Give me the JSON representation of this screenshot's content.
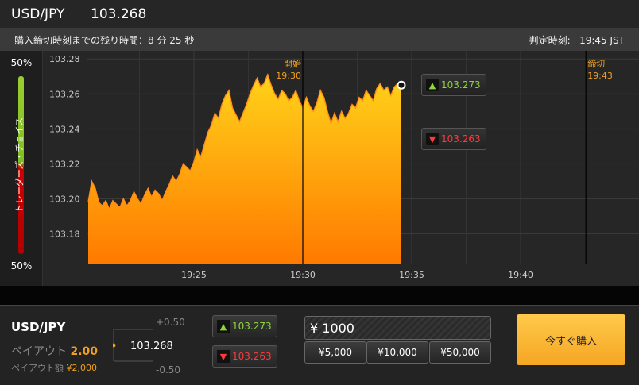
{
  "header": {
    "pair": "USD/JPY",
    "price": "103.268"
  },
  "subbar": {
    "remaining_label": "購入締切時刻までの残り時間：8 分 25 秒",
    "judge_label": "判定時刻:",
    "judge_time": "19:45 JST"
  },
  "traders_choice": {
    "label": "トレーダーズ・チョイス",
    "top_pct": "50%",
    "bottom_pct": "50%",
    "arrow": "‹"
  },
  "chart_data": {
    "type": "area",
    "y_ticks": [
      "103.28",
      "103.26",
      "103.24",
      "103.22",
      "103.20",
      "103.18"
    ],
    "x_ticks": [
      "19:25",
      "19:30",
      "19:35",
      "19:40"
    ],
    "ylim": [
      103.163,
      103.281
    ],
    "markers": [
      {
        "label": "開始",
        "time": "19:30"
      },
      {
        "label": "締切",
        "time": "19:43"
      }
    ],
    "current_price": "103.268",
    "series": [
      {
        "values": [
          103.198,
          103.21,
          103.206,
          103.198,
          103.196,
          103.199,
          103.194,
          103.199,
          103.197,
          103.195,
          103.2,
          103.196,
          103.199,
          103.204,
          103.2,
          103.197,
          103.202,
          103.206,
          103.201,
          103.205,
          103.203,
          103.199,
          103.204,
          103.208,
          103.213,
          103.21,
          103.214,
          103.22,
          103.218,
          103.216,
          103.221,
          103.228,
          103.224,
          103.231,
          103.238,
          103.242,
          103.249,
          103.246,
          103.254,
          103.259,
          103.262,
          103.252,
          103.248,
          103.244,
          103.249,
          103.254,
          103.26,
          103.265,
          103.269,
          103.264,
          103.266,
          103.271,
          103.265,
          103.26,
          103.257,
          103.262,
          103.26,
          103.256,
          103.258,
          103.262,
          103.256,
          103.252,
          103.258,
          103.253,
          103.25,
          103.255,
          103.262,
          103.258,
          103.25,
          103.243,
          103.249,
          103.244,
          103.25,
          103.246,
          103.249,
          103.254,
          103.252,
          103.258,
          103.256,
          103.262,
          103.259,
          103.256,
          103.263,
          103.266,
          103.262,
          103.264,
          103.259,
          103.264,
          103.266,
          103.265
        ]
      }
    ]
  },
  "indicators": {
    "high": "103.273",
    "low": "103.263"
  },
  "bottom": {
    "pair": "USD/JPY",
    "payout_label": "ペイアウト",
    "payout_value": "2.00",
    "payout_amount_label": "ペイアウト額",
    "payout_amount_value": "¥2,000",
    "plus": "+0.50",
    "minus": "-0.50",
    "center_price": "103.268",
    "high": "103.273",
    "low": "103.263",
    "amount": "¥ 1000",
    "quick": [
      "¥5,000",
      "¥10,000",
      "¥50,000"
    ],
    "buy_label": "今すぐ購入"
  },
  "colors": {
    "up": "#8ed63a",
    "down": "#ff3a3a",
    "accent": "#f5a623"
  }
}
